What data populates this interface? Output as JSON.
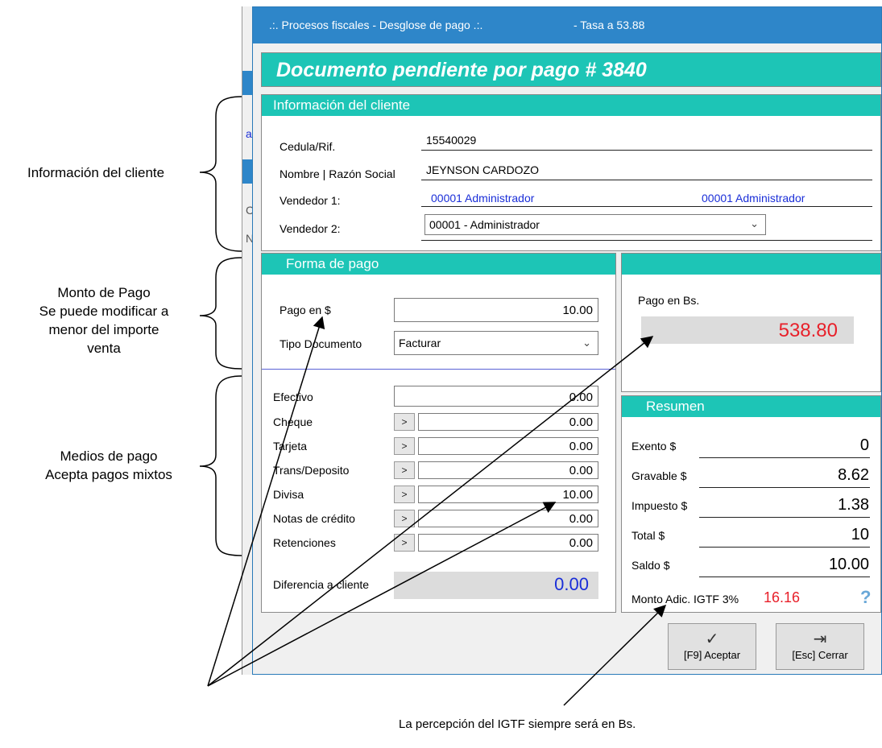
{
  "dialog": {
    "title": ".:. Procesos fiscales - Desglose de pago .:.",
    "rate": "- Tasa a 53.88",
    "banner": "Documento pendiente por pago # 3840"
  },
  "client": {
    "header": "Información del cliente",
    "cedula_label": "Cedula/Rif.",
    "cedula_value": "15540029",
    "name_label": "Nombre | Razón Social",
    "name_value": "JEYNSON CARDOZO",
    "vendor1_label": "Vendedor 1:",
    "vendor1_value": "00001 Administrador",
    "vendor1_value2": "00001 Administrador",
    "vendor2_label": "Vendedor 2:",
    "vendor2_value": "00001 - Administrador"
  },
  "payment": {
    "header": "Forma de pago",
    "pago_usd_label": "Pago en $",
    "pago_usd_value": "10.00",
    "tipo_doc_label": "Tipo Documento",
    "tipo_doc_value": "Facturar",
    "efectivo_label": "Efectivo",
    "efectivo_value": "0.00",
    "methods": [
      {
        "label": "Cheque",
        "btn": ">",
        "value": "0.00"
      },
      {
        "label": "Tarjeta",
        "btn": ">",
        "value": "0.00"
      },
      {
        "label": "Trans/Deposito",
        "btn": ">",
        "value": "0.00"
      },
      {
        "label": "Divisa",
        "btn": ">",
        "value": "10.00"
      },
      {
        "label": "Notas de crédito",
        "btn": ">",
        "value": "0.00"
      },
      {
        "label": "Retenciones",
        "btn": ">",
        "value": "0.00"
      }
    ],
    "diferencia_label": "Diferencia a cliente",
    "diferencia_value": "0.00"
  },
  "bs": {
    "label": "Pago en Bs.",
    "value": "538.80"
  },
  "summary": {
    "header": "Resumen",
    "rows": [
      {
        "label": "Exento $",
        "value": "0"
      },
      {
        "label": "Gravable $",
        "value": "8.62"
      },
      {
        "label": "Impuesto $",
        "value": "1.38"
      },
      {
        "label": "Total $",
        "value": "10"
      },
      {
        "label": "Saldo $",
        "value": "10.00"
      }
    ],
    "igtf_label": "Monto Adic. IGTF 3%",
    "igtf_value": "16.16",
    "help": "?"
  },
  "buttons": {
    "accept": "[F9] Aceptar",
    "close": "[Esc] Cerrar"
  },
  "annotations": {
    "client_info": "Información del cliente",
    "monto_1": "Monto de Pago",
    "monto_2": "Se puede modificar a",
    "monto_3": "menor del importe",
    "monto_4": "venta",
    "medios_1": "Medios de pago",
    "medios_2": "Acepta pagos mixtos",
    "igtf_note": "La percepción del IGTF siempre será en Bs."
  },
  "background_window": {
    "fragment_a": "a",
    "fragment_c": "C",
    "fragment_n": "N"
  },
  "colors": {
    "titlebar": "#2e86c9",
    "teal": "#1dc5b6",
    "red_value": "#e8202a",
    "blue_value": "#1a2ed8"
  }
}
